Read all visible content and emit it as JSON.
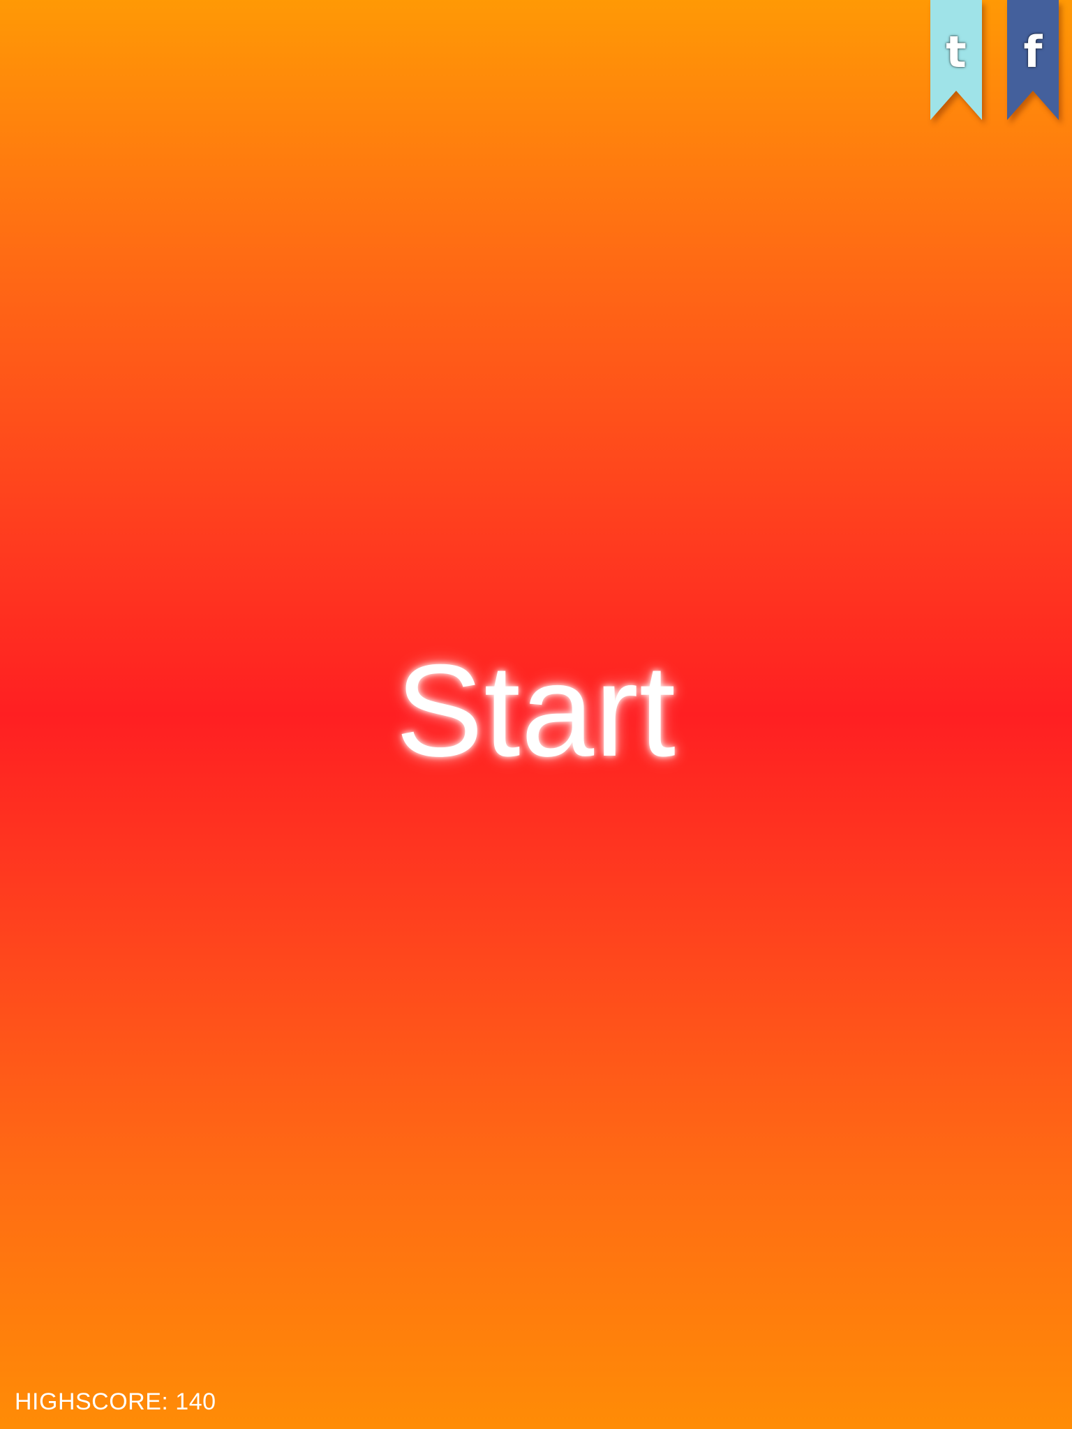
{
  "colors": {
    "background_top": "#ff9905",
    "background_middle": "#ff1f22",
    "background_bottom": "#ff8c06",
    "tumblr_ribbon": "#9fe3e8",
    "facebook_ribbon": "#44609c",
    "text": "#ffffff"
  },
  "social": {
    "tumblr": {
      "icon": "tumblr-icon",
      "glyph": "t"
    },
    "facebook": {
      "icon": "facebook-icon",
      "glyph": "f"
    }
  },
  "main": {
    "start_label": "Start"
  },
  "footer": {
    "highscore_text": "HIGHSCORE: 140"
  }
}
